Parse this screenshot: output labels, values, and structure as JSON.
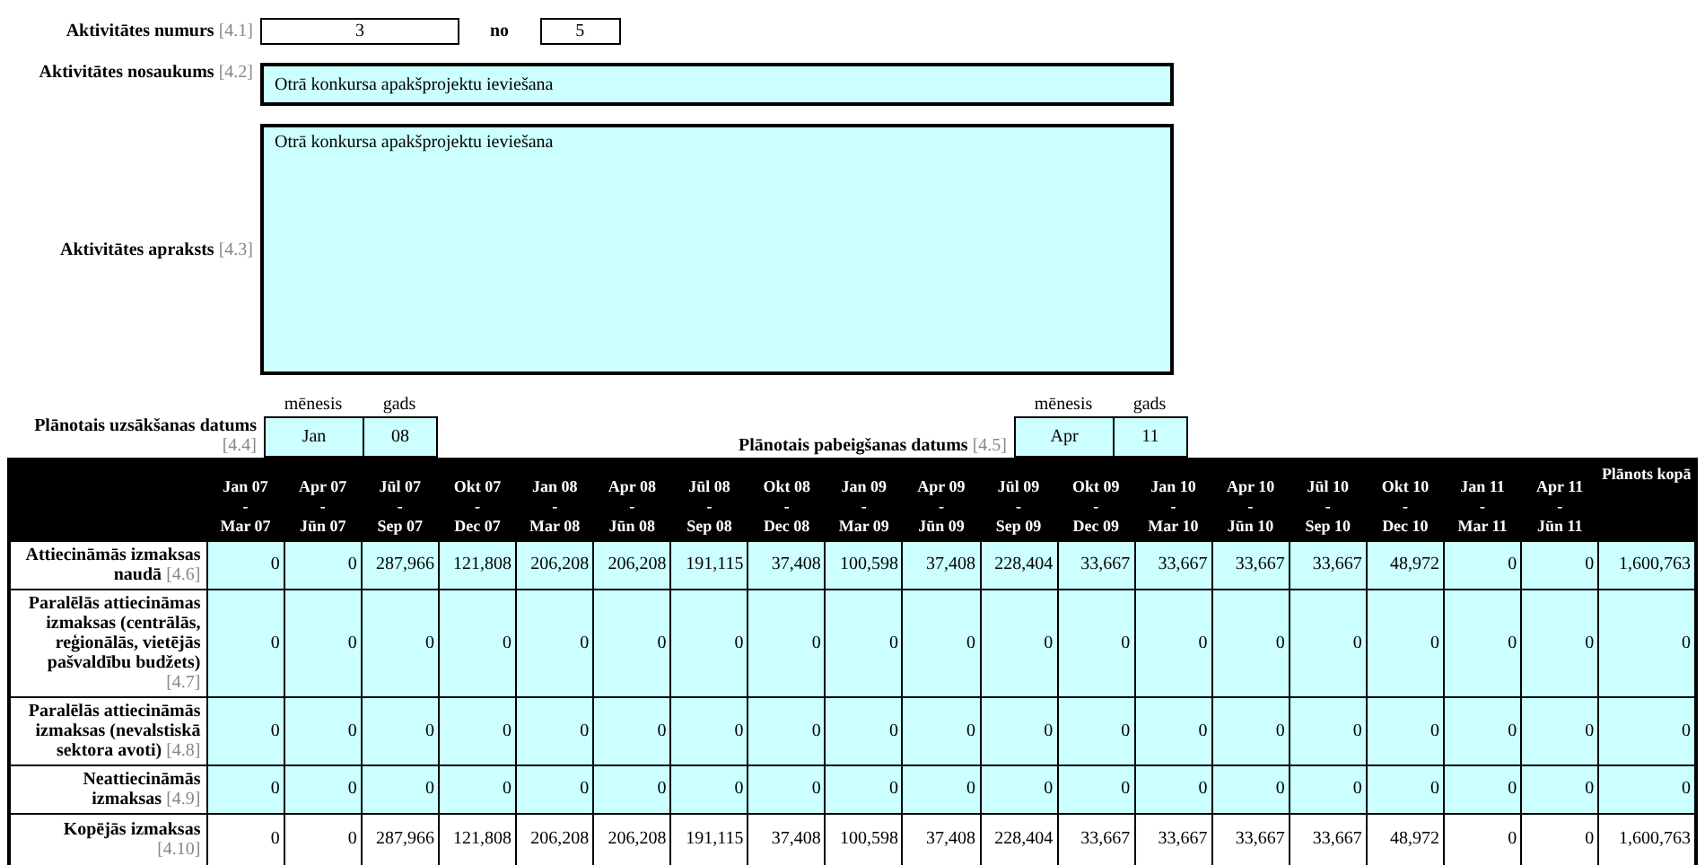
{
  "activity_number": {
    "label": "Aktivitātes numurs",
    "ref": "[4.1]",
    "value": "3",
    "of_label": "no",
    "total": "5"
  },
  "activity_name": {
    "label": "Aktivitātes nosaukums",
    "ref": "[4.2]",
    "value": "Otrā konkursa apakšprojektu ieviešana"
  },
  "activity_description": {
    "label": "Aktivitātes apraksts",
    "ref": "[4.3]",
    "value": "Otrā konkursa apakšprojektu ieviešana"
  },
  "start_date": {
    "label": "Plānotais uzsākšanas datums",
    "ref": "[4.4]",
    "month_header": "mēnesis",
    "year_header": "gads",
    "month": "Jan",
    "year": "08"
  },
  "end_date": {
    "label": "Plānotais pabeigšanas datums",
    "ref": "[4.5]",
    "month_header": "mēnesis",
    "year_header": "gads",
    "month": "Apr",
    "year": "11"
  },
  "table": {
    "columns": [
      {
        "from": "Jan 07",
        "sep": "-",
        "to": "Mar 07"
      },
      {
        "from": "Apr 07",
        "sep": "-",
        "to": "Jūn 07"
      },
      {
        "from": "Jūl 07",
        "sep": "-",
        "to": "Sep 07"
      },
      {
        "from": "Okt 07",
        "sep": "-",
        "to": "Dec 07"
      },
      {
        "from": "Jan 08",
        "sep": "-",
        "to": "Mar 08"
      },
      {
        "from": "Apr 08",
        "sep": "-",
        "to": "Jūn 08"
      },
      {
        "from": "Jūl 08",
        "sep": "-",
        "to": "Sep 08"
      },
      {
        "from": "Okt 08",
        "sep": "-",
        "to": "Dec 08"
      },
      {
        "from": "Jan 09",
        "sep": "-",
        "to": "Mar 09"
      },
      {
        "from": "Apr 09",
        "sep": "-",
        "to": "Jūn 09"
      },
      {
        "from": "Jūl 09",
        "sep": "-",
        "to": "Sep 09"
      },
      {
        "from": "Okt 09",
        "sep": "-",
        "to": "Dec 09"
      },
      {
        "from": "Jan 10",
        "sep": "-",
        "to": "Mar 10"
      },
      {
        "from": "Apr 10",
        "sep": "-",
        "to": "Jūn 10"
      },
      {
        "from": "Jūl 10",
        "sep": "-",
        "to": "Sep 10"
      },
      {
        "from": "Okt 10",
        "sep": "-",
        "to": "Dec 10"
      },
      {
        "from": "Jan 11",
        "sep": "-",
        "to": "Mar 11"
      },
      {
        "from": "Apr 11",
        "sep": "-",
        "to": "Jūn 11"
      }
    ],
    "total_header": "Plānots kopā",
    "rows": [
      {
        "kind": "input",
        "label": "Attiecināmās izmaksas naudā",
        "ref": "[4.6]",
        "values": [
          "0",
          "0",
          "287,966",
          "121,808",
          "206,208",
          "206,208",
          "191,115",
          "37,408",
          "100,598",
          "37,408",
          "228,404",
          "33,667",
          "33,667",
          "33,667",
          "33,667",
          "48,972",
          "0",
          "0"
        ],
        "total": "1,600,763"
      },
      {
        "kind": "input",
        "label": "Paralēlās attiecināmas izmaksas (centrālās, reģionālās, vietējās pašvaldību budžets)",
        "ref": "[4.7]",
        "values": [
          "0",
          "0",
          "0",
          "0",
          "0",
          "0",
          "0",
          "0",
          "0",
          "0",
          "0",
          "0",
          "0",
          "0",
          "0",
          "0",
          "0",
          "0"
        ],
        "total": "0"
      },
      {
        "kind": "input",
        "label": "Paralēlās attiecināmās izmaksas (nevalstiskā sektora avoti)",
        "ref": "[4.8]",
        "values": [
          "0",
          "0",
          "0",
          "0",
          "0",
          "0",
          "0",
          "0",
          "0",
          "0",
          "0",
          "0",
          "0",
          "0",
          "0",
          "0",
          "0",
          "0"
        ],
        "total": "0"
      },
      {
        "kind": "input",
        "label": "Neattiecināmās izmaksas",
        "ref": "[4.9]",
        "values": [
          "0",
          "0",
          "0",
          "0",
          "0",
          "0",
          "0",
          "0",
          "0",
          "0",
          "0",
          "0",
          "0",
          "0",
          "0",
          "0",
          "0",
          "0"
        ],
        "total": "0"
      },
      {
        "kind": "total",
        "label": "Kopējās izmaksas",
        "ref": "[4.10]",
        "values": [
          "0",
          "0",
          "287,966",
          "121,808",
          "206,208",
          "206,208",
          "191,115",
          "37,408",
          "100,598",
          "37,408",
          "228,404",
          "33,667",
          "33,667",
          "33,667",
          "33,667",
          "48,972",
          "0",
          "0"
        ],
        "total": "1,600,763"
      }
    ]
  }
}
